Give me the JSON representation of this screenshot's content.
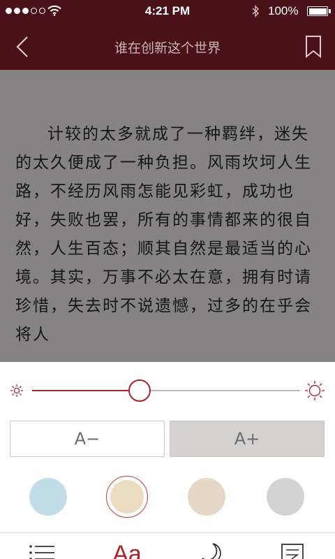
{
  "status_bar": {
    "time": "4:21 PM",
    "battery": "100%",
    "icons": [
      "signal-dots",
      "wifi-icon",
      "bluetooth-icon",
      "battery-icon"
    ]
  },
  "nav": {
    "title": "谁在创新这个世界",
    "icons": [
      "back-chevron-icon",
      "bookmark-icon"
    ]
  },
  "reader": {
    "paragraph": "计较的太多就成了一种羁绊，迷失的太久便成了一种负担。风雨坎坷人生路，不经历风雨怎能见彩虹，成功也好，失败也罢，所有的事情都来的很自然，人生百态；顺其自然是最适当的心境。其实，万事不必太在意，拥有时请珍惜，失去时不说遗憾，过多的在乎会将人",
    "background_color": "#858383"
  },
  "settings": {
    "brightness": 0.4,
    "brightness_icons": [
      "sun-small-icon",
      "sun-large-icon"
    ],
    "font_decrease_label": "A−",
    "font_increase_label": "A+",
    "themes": [
      {
        "name": "blue",
        "color": "#c2dde8",
        "selected": false
      },
      {
        "name": "cream",
        "color": "#ebdcbf",
        "selected": true
      },
      {
        "name": "beige",
        "color": "#e5d9c6",
        "selected": false
      },
      {
        "name": "gray",
        "color": "#d3d3d3",
        "selected": false
      }
    ],
    "accent_color": "#a8252d"
  },
  "toolbar": {
    "font_label": "Aa",
    "icons": [
      "list-icon",
      "font-icon",
      "moon-icon",
      "edit-icon"
    ]
  }
}
